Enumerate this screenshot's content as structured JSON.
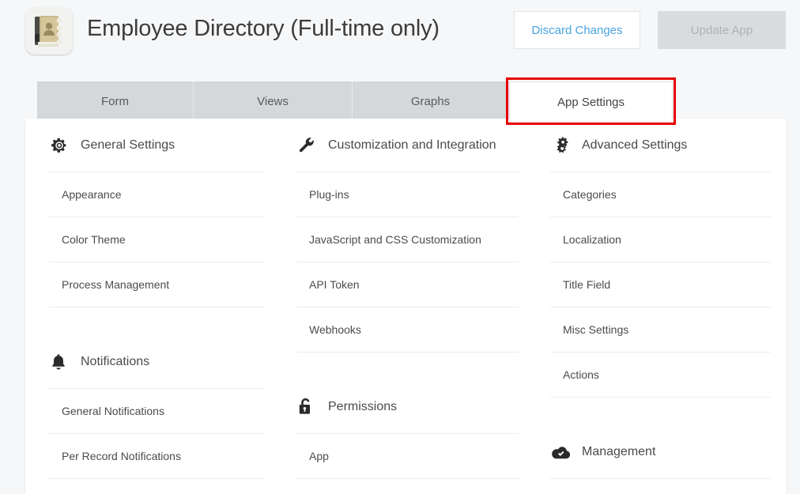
{
  "header": {
    "app_icon_name": "address-book-icon",
    "title": "Employee Directory (Full-time only)",
    "discard_label": "Discard Changes",
    "update_label": "Update App",
    "discard_text_color": "#4aa3df",
    "update_bg_color": "#d9dbdd",
    "update_text_color": "#b0b3b6"
  },
  "tabs": {
    "highlight_color": "#e60000",
    "items": [
      {
        "label": "Form",
        "active": false
      },
      {
        "label": "Views",
        "active": false
      },
      {
        "label": "Graphs",
        "active": false
      },
      {
        "label": "App Settings",
        "active": true
      }
    ]
  },
  "settings": {
    "columns": [
      {
        "sections": [
          {
            "icon": "gear-icon",
            "title": "General Settings",
            "items": [
              "Appearance",
              "Color Theme",
              "Process Management"
            ]
          },
          {
            "icon": "bell-icon",
            "title": "Notifications",
            "items": [
              "General Notifications",
              "Per Record Notifications"
            ]
          }
        ]
      },
      {
        "sections": [
          {
            "icon": "wrench-icon",
            "title": "Customization and Integration",
            "items": [
              "Plug-ins",
              "JavaScript and CSS Customization",
              "API Token",
              "Webhooks"
            ]
          },
          {
            "icon": "lock-icon",
            "title": "Permissions",
            "items": [
              "App"
            ]
          }
        ]
      },
      {
        "sections": [
          {
            "icon": "double-gear-icon",
            "title": "Advanced Settings",
            "items": [
              "Categories",
              "Localization",
              "Title Field",
              "Misc Settings",
              "Actions"
            ]
          },
          {
            "icon": "cloud-check-icon",
            "title": "Management",
            "items": []
          }
        ]
      }
    ]
  }
}
